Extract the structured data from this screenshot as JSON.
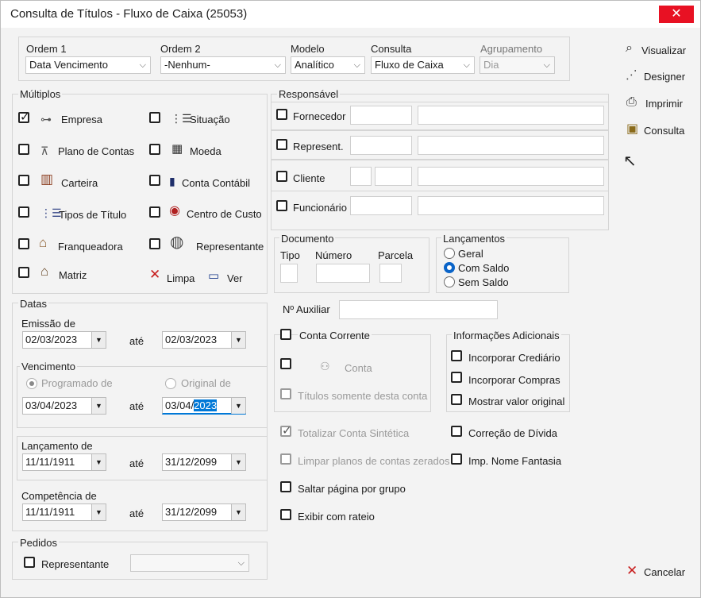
{
  "window": {
    "title": "Consulta de Títulos - Fluxo de Caixa (25053)",
    "close": "✕"
  },
  "top": {
    "ordem1": {
      "label": "Ordem 1",
      "value": "Data Vencimento"
    },
    "ordem2": {
      "label": "Ordem 2",
      "value": "-Nenhum-"
    },
    "modelo": {
      "label": "Modelo",
      "value": "Analítico"
    },
    "consulta": {
      "label": "Consulta",
      "value": "Fluxo de Caixa"
    },
    "agrupamento": {
      "label": "Agrupamento",
      "value": "Dia"
    }
  },
  "multiplos": {
    "label": "Múltiplos",
    "items": [
      {
        "label": "Empresa",
        "checked": true
      },
      {
        "label": "Situação",
        "checked": false
      },
      {
        "label": "Plano de Contas",
        "checked": false
      },
      {
        "label": "Moeda",
        "checked": false
      },
      {
        "label": "Carteira",
        "checked": false
      },
      {
        "label": "Conta Contábil",
        "checked": false
      },
      {
        "label": "Tipos de Título",
        "checked": false
      },
      {
        "label": "Centro de Custo",
        "checked": false
      },
      {
        "label": "Franqueadora",
        "checked": false
      },
      {
        "label": "Representante",
        "checked": false
      },
      {
        "label": "Matriz",
        "checked": false
      }
    ],
    "limpa": "Limpa",
    "ver": "Ver"
  },
  "responsavel": {
    "label": "Responsável",
    "rows": [
      "Fornecedor",
      "Represent.",
      "Cliente",
      "Funcionário"
    ]
  },
  "datas": {
    "label": "Datas",
    "emissao": {
      "label": "Emissão de",
      "from": "02/03/2023",
      "to": "02/03/2023"
    },
    "vencimento": {
      "label": "Vencimento",
      "programado": "Programado de",
      "original": "Original de",
      "from": "03/04/2023",
      "to_prefix": "03/04/",
      "to_selected": "2023"
    },
    "lancamento": {
      "label": "Lançamento de",
      "from": "11/11/1911",
      "to": "31/12/2099"
    },
    "competencia": {
      "label": "Competência de",
      "from": "11/11/1911",
      "to": "31/12/2099"
    },
    "ate": "até"
  },
  "pedidos": {
    "label": "Pedidos",
    "representante": "Representante"
  },
  "documento": {
    "label": "Documento",
    "tipo": "Tipo",
    "numero": "Número",
    "parcela": "Parcela"
  },
  "lancamentos": {
    "label": "Lançamentos",
    "geral": "Geral",
    "com_saldo": "Com Saldo",
    "sem_saldo": "Sem Saldo"
  },
  "auxiliar": {
    "label": "Nº Auxiliar"
  },
  "conta_corrente": {
    "label": "Conta Corrente",
    "conta": "Conta",
    "somente": "Títulos somente desta conta"
  },
  "info": {
    "label": "Informações Adicionais",
    "crediario": "Incorporar Crediário",
    "compras": "Incorporar Compras",
    "valor_original": "Mostrar valor original"
  },
  "options": {
    "totalizar": "Totalizar Conta Sintética",
    "limpar": "Limpar planos de contas zerados",
    "saltar": "Saltar página por grupo",
    "rateio": "Exibir com rateio",
    "correcao": "Correção de Dívida",
    "fantasia": "Imp. Nome Fantasia"
  },
  "side": {
    "visualizar": "Visualizar",
    "designer": "Designer",
    "imprimir": "Imprimir",
    "consulta": "Consulta",
    "cancelar": "Cancelar"
  }
}
